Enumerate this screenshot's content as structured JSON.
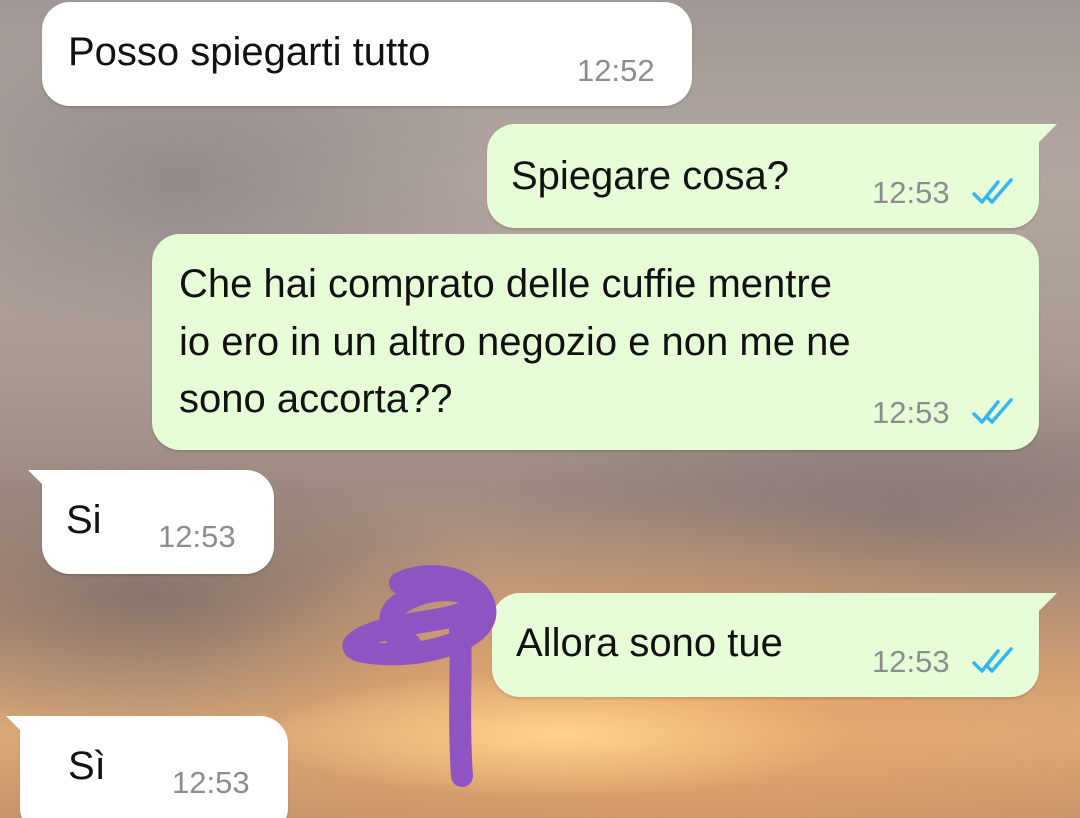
{
  "messages": [
    {
      "id": "m1",
      "direction": "incoming",
      "text": "Posso spiegarti tutto",
      "time": "12:52"
    },
    {
      "id": "m2",
      "direction": "outgoing",
      "text": "Spiegare cosa?",
      "time": "12:53",
      "status": "read"
    },
    {
      "id": "m3",
      "direction": "outgoing",
      "lines": [
        "Che hai comprato delle cuffie mentre",
        "io ero in un altro negozio e non me ne",
        "sono accorta??"
      ],
      "time": "12:53",
      "status": "read"
    },
    {
      "id": "m4",
      "direction": "incoming",
      "text": "Si",
      "time": "12:53"
    },
    {
      "id": "m5",
      "direction": "outgoing",
      "text": "Allora sono tue",
      "time": "12:53",
      "status": "read"
    },
    {
      "id": "m6",
      "direction": "incoming",
      "text": "Sì",
      "time": "12:53"
    }
  ],
  "colors": {
    "incoming_bubble": "#ffffff",
    "outgoing_bubble": "#e7fdd8",
    "read_ticks": "#34b7f1",
    "timestamp": "#8a8f8d",
    "doodle": "#8e55c2"
  },
  "icons": {
    "read_receipt": "double-check-icon",
    "annotation": "hand-drawn-purple-doodle"
  }
}
